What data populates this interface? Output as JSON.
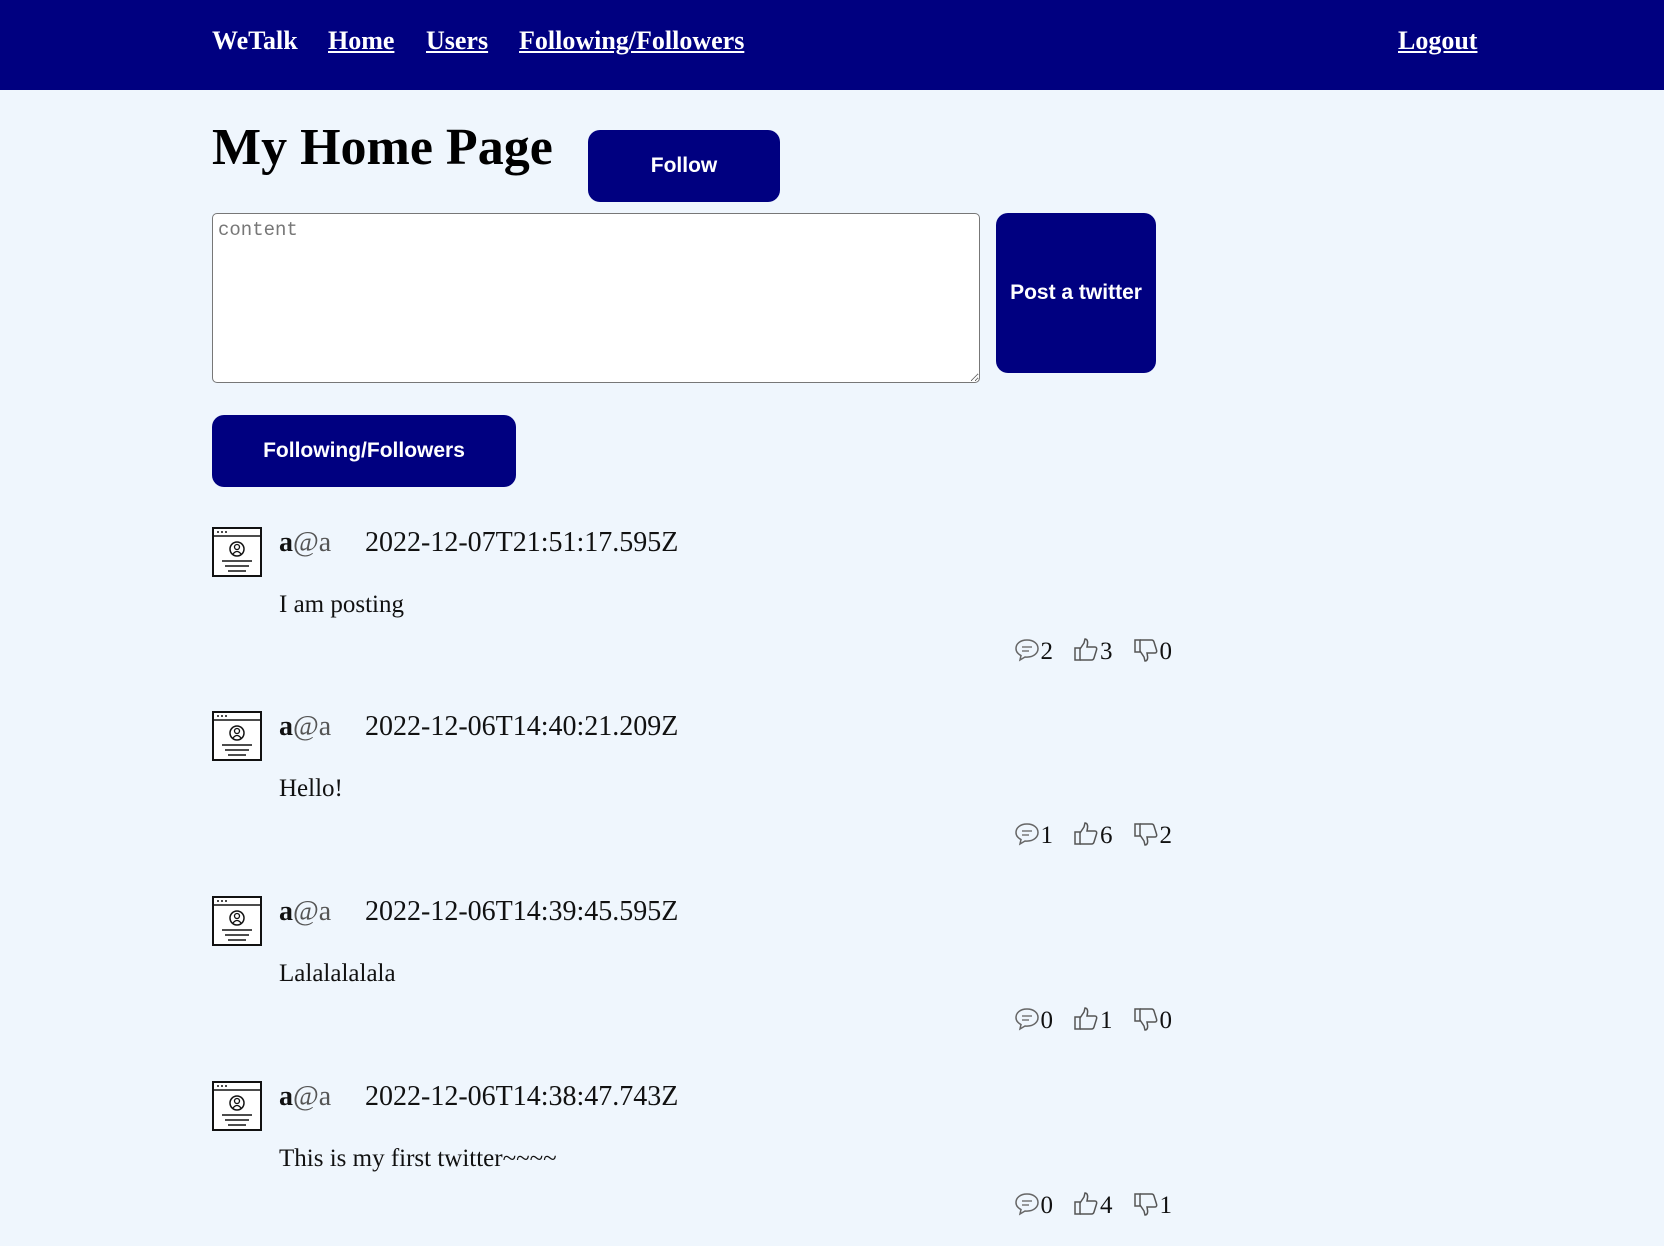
{
  "nav": {
    "brand": "WeTalk",
    "home": "Home",
    "users": "Users",
    "following_followers": "Following/Followers",
    "logout": "Logout"
  },
  "page": {
    "title": "My Home Page",
    "follow_button": "Follow",
    "content_placeholder": "content",
    "post_button": "Post a twitter",
    "following_followers_button": "Following/Followers"
  },
  "posts": [
    {
      "user": "a",
      "domain": "@a",
      "time": "2022-12-07T21:51:17.595Z",
      "text": "I am posting",
      "comments": "2",
      "likes": "3",
      "dislikes": "0"
    },
    {
      "user": "a",
      "domain": "@a",
      "time": "2022-12-06T14:40:21.209Z",
      "text": "Hello!",
      "comments": "1",
      "likes": "6",
      "dislikes": "2"
    },
    {
      "user": "a",
      "domain": "@a",
      "time": "2022-12-06T14:39:45.595Z",
      "text": "Lalalalalala",
      "comments": "0",
      "likes": "1",
      "dislikes": "0"
    },
    {
      "user": "a",
      "domain": "@a",
      "time": "2022-12-06T14:38:47.743Z",
      "text": "This is my first twitter~~~~",
      "comments": "0",
      "likes": "4",
      "dislikes": "1"
    }
  ],
  "colors": {
    "nav_bg": "#000080",
    "button_bg": "#000080",
    "page_bg": "#eff6fd"
  },
  "icons": {
    "avatar": "profile-window-icon",
    "comment": "comment-icon",
    "like": "thumbs-up-icon",
    "dislike": "thumbs-down-icon"
  }
}
